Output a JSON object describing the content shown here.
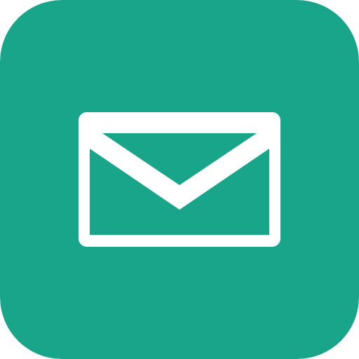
{
  "app_icon": {
    "icon": "mail-icon",
    "background_color": "#18A589",
    "glyph_color": "#FFFFFF"
  }
}
